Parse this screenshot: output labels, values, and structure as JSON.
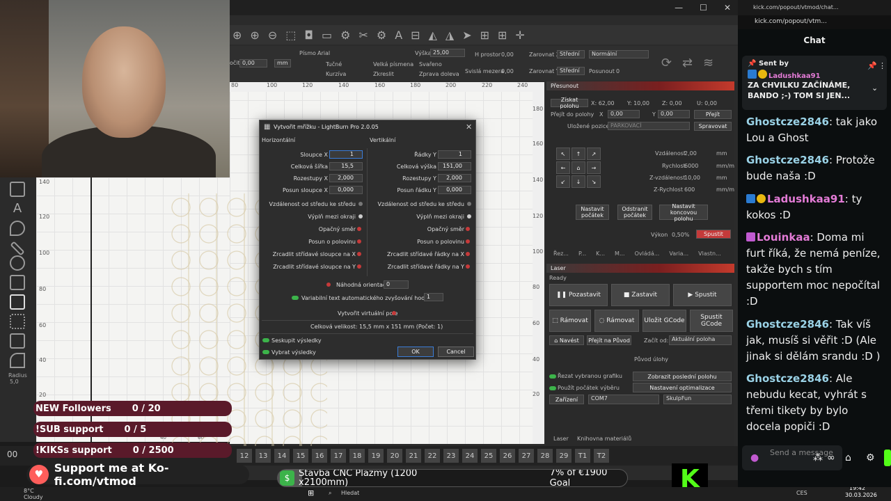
{
  "lightburn": {
    "window_controls": [
      "—",
      "☐",
      "✕"
    ],
    "props": {
      "font_label": "Písmo",
      "font_value": "Arial",
      "height_label": "Výška",
      "height_value": "25,00",
      "hspace_label": "H prostor",
      "hspace_value": "0,00",
      "vspace_label": "Svislá mezera",
      "vspace_value": "0,00",
      "align_x_label": "Zarovnat X",
      "align_x_value": "Střední",
      "align_y_label": "Zarovnat Y",
      "align_y_value": "Střední",
      "normal_value": "Normální",
      "offset_label": "Posunout",
      "offset_value": "0",
      "count_label": "očit",
      "count_value": "0,00",
      "unit": "mm",
      "bold": "Tučné",
      "italic": "Kurzíva",
      "upper": "Velká písmena",
      "distort": "Zkreslit",
      "welded": "Svařeno",
      "rtl": "Zprava doleva"
    },
    "ruler_top": [
      "80",
      "100",
      "120",
      "140",
      "160",
      "180",
      "200",
      "220",
      "240"
    ],
    "ruler_side": [
      "180",
      "160",
      "140",
      "120",
      "100",
      "80",
      "60",
      "40",
      "20"
    ],
    "left_ruler": [
      "140",
      "120",
      "100",
      "80",
      "60",
      "40",
      "20"
    ],
    "left_ruler_bottom": [
      "40",
      "60"
    ],
    "move_panel": {
      "header": "Přesunout",
      "get_pos": "Získat polohu",
      "x": "X: 62,00",
      "y": "Y: 10,00",
      "z": "Z: 0,00",
      "u": "U: 0,00",
      "goto": "Přejít do polohy",
      "x_val": "0,00",
      "y_val": "0,00",
      "goto_btn": "Přejít",
      "saved": "Uložené pozice:",
      "saved_val": "PARKOVACÍ",
      "manage": "Spravovat",
      "distance_label": "Vzdálenost",
      "distance": "2,00",
      "rate_label": "Rychlost",
      "rate": "6000",
      "zdist_label": "Z-vzdálenost",
      "zdist": "10,00",
      "zrate_label": "Z-Rychlost",
      "zrate": "600",
      "mm": "mm",
      "mmm": "mm/m",
      "set_origin": "Nastavit počátek",
      "clear_origin": "Odstranit počátek",
      "set_end": "Nastavit koncovou polohu",
      "power_label": "Výkon",
      "power": "0,50%",
      "fire": "Spustit",
      "tabs": [
        "Řez...",
        "P...",
        "K...",
        "M...",
        "Ovládá...",
        "Varia...",
        "Vlastn..."
      ]
    },
    "laser_panel": {
      "header": "Laser",
      "status": "Ready",
      "pause": "Pozastavit",
      "stop": "Zastavit",
      "start": "Spustit",
      "frame1": "Rámovat",
      "frame2": "Rámovat",
      "save_gcode": "Uložit GCode",
      "run_gcode": "Spustit GCode",
      "home": "Navést",
      "goto_origin": "Přejít na Původ",
      "start_from": "Začít od:",
      "start_from_val": "Aktuální poloha",
      "job_origin": "Původ úlohy",
      "cut_selected": "Řezat vybranou grafiku",
      "use_sel_origin": "Použít počátek výběru",
      "show_last": "Zobrazit poslední polohu",
      "opt_settings": "Nastavení optimalizace",
      "devices": "Zařízení",
      "port": "COM7",
      "device": "SkulpFun",
      "bottom_tabs": [
        "Laser",
        "Knihovna materiálů"
      ]
    },
    "number_strip": [
      "12",
      "13",
      "14",
      "15",
      "16",
      "17",
      "18",
      "19",
      "20",
      "21",
      "22",
      "23",
      "24",
      "25",
      "26",
      "27",
      "28",
      "29",
      "T1",
      "T2"
    ],
    "left_00": "00",
    "radius_label": "Radius",
    "radius_value": "5,0"
  },
  "dialog": {
    "title": "Vytvořit mřížku - LightBurn Pro 2.0.05",
    "h_section": "Horizontální",
    "v_section": "Vertikální",
    "cols_label": "Sloupce X",
    "cols": "1",
    "total_w_label": "Celková šířka",
    "total_w": "15,5",
    "spacing_x_label": "Rozestupy X",
    "spacing_x": "2,000",
    "shift_cols_label": "Posun sloupce X",
    "shift_cols": "0,000",
    "center_h": "Vzdálenost od středu ke středu",
    "fill_h": "Výplň mezi okraji",
    "reverse_h": "Opačný směr",
    "half_h": "Posun o polovinu",
    "mirror_x": "Zrcadlit střídavé sloupce na X",
    "mirror_y": "Zrcadlit střídavé sloupce na Y",
    "rows_label": "Řádky Y",
    "rows": "1",
    "total_h_label": "Celková výška",
    "total_h": "151,00",
    "spacing_y_label": "Rozestupy Y",
    "spacing_y": "2,000",
    "shift_rows_label": "Posun řádku Y",
    "shift_rows": "0,000",
    "center_v": "Vzdálenost od středu ke středu",
    "fill_v": "Výplň mezi okraji",
    "reverse_v": "Opačný směr",
    "half_v": "Posun o polovinu",
    "mirror_rx": "Zrcadlit střídavé řádky na X",
    "mirror_ry": "Zrcadlit střídavé řádky na Y",
    "random_label": "Náhodná orientace",
    "random": "0",
    "variable_label": "Variabilní text automatického zvyšování hodnoty",
    "variable": "1",
    "virtual": "Vytvořit virtuální pole",
    "total_size": "Celková velikost: 15,5 mm x 151 mm  (Počet: 1)",
    "group": "Seskupit výsledky",
    "select": "Vybrat výsledky",
    "ok": "OK",
    "cancel": "Cancel"
  },
  "overlay": {
    "followers_label": "NEW Followers",
    "followers_count": "0 / 20",
    "sub_label": "!SUB support",
    "sub_count": "0 / 5",
    "kiks_label": "!KIKSs support",
    "kiks_count": "0 / 2500",
    "kofi": "Support me at Ko-fi.com/vtmod",
    "goal_name": "Stavba CNC Plazmy (1200 x2100mm)",
    "goal_pct_text": "7% of €1900 Goal",
    "goal_progress": 0.07,
    "kick_logo": "K"
  },
  "taskbar": {
    "weather_temp": "8°C",
    "weather_desc": "Cloudy",
    "search": "Hledat",
    "lang": "CES",
    "time": "19:42",
    "date": "30.03.2026"
  },
  "chat": {
    "tab_title": "kick.com/popout/vtmod/chat...",
    "url": "kick.com/popout/vtm...",
    "header": "Chat",
    "pinned_sent_by": "Sent by",
    "pinned_user": "Ladushkaa91",
    "pinned_text": "ZA CHVILKU ZAČÍNÁME, BANDO ;-) TOM SI JEN...",
    "messages": [
      {
        "user": "Ghostcze2846",
        "text": ": tak jako Lou a Ghost"
      },
      {
        "user": "Ghostcze2846",
        "text": ": Protože bude naša :D"
      },
      {
        "user": "Ladushkaa91",
        "text": ": ty kokos :D"
      },
      {
        "user": "Louinkaa",
        "text": ": Doma mi furt říká, že nemá peníze, takže bych s tím supportem moc nepočítal :D"
      },
      {
        "user": "Ghostcze2846",
        "text": ": Tak víš jak, musíš si věřit :D (Ale jinak si dělám srandu :D )"
      },
      {
        "user": "Ghostcze2846",
        "text": ": Ale nebudu kecat, vyhrát s třemi tikety by bylo docela popiči :D"
      }
    ],
    "input_placeholder": "Send a message",
    "colors": {
      "user": "#9ad2e6",
      "pink": "#e37bd6",
      "accent": "#53fc18"
    }
  }
}
